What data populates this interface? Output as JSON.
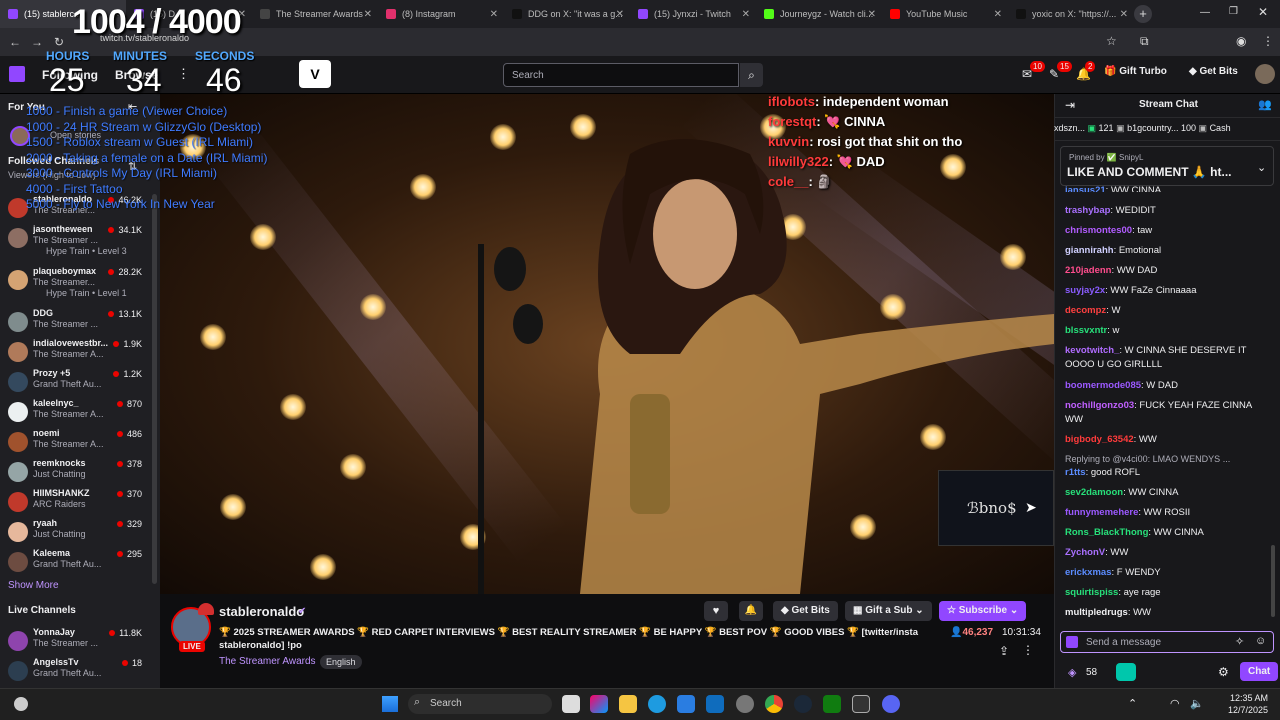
{
  "colors": {
    "accent": "#9147ff",
    "live_red": "#eb0400",
    "timer_blue": "#52a9ff"
  },
  "browser": {
    "tabs": [
      {
        "title": "(15) stablerc...",
        "color": "#9147ff"
      },
      {
        "title": "(15) D...",
        "color": "#9147ff"
      },
      {
        "title": "The Streamer Awards",
        "color": "#444"
      },
      {
        "title": "(8) Instagram",
        "color": "#e1306c"
      },
      {
        "title": "DDG on X: \"it was a g...",
        "color": "#111"
      },
      {
        "title": "(15) Jynxzi - Twitch",
        "color": "#9147ff"
      },
      {
        "title": "Journeygz - Watch cli...",
        "color": "#53fc18"
      },
      {
        "title": "YouTube Music",
        "color": "#ff0000"
      },
      {
        "title": "yoxic on X: \"https://...",
        "color": "#111"
      }
    ],
    "url": "twitch.tv/stableronaldo"
  },
  "topnav": {
    "following": "Following",
    "browse": "Browse",
    "search_placeholder": "Search",
    "badges": [
      "10",
      "15",
      "2"
    ],
    "gift_turbo": "Gift Turbo",
    "get_bits": "Get Bits"
  },
  "timer": {
    "progress": "1004 / 4000",
    "hours_label": "HOURS",
    "minutes_label": "MINUTES",
    "seconds_label": "SECONDS",
    "hours": "25",
    "minutes": "34",
    "seconds": "46",
    "goals": [
      "1000 - Finish a game (Viewer Choice)",
      "1000 - 24 HR Stream w GlizzyGlo (Desktop)",
      "1500 - Roblox stream w Guest (IRL Miami)",
      "2000 - Taking a female on a Date (IRL Miami)",
      "3000 - Controls My Day (IRL Miami)",
      "4000 - First Tattoo",
      "5000 - Fly to New York In New Year"
    ]
  },
  "sidebar": {
    "for_you": "For You",
    "open_stories": "Open stories",
    "followed": "Followed Channels",
    "sort": "Viewers (High to Low)",
    "channels": [
      {
        "name": "stableronaldo",
        "category": "The Streamer...",
        "viewers": "46.2K",
        "sub": "",
        "color": "#c0392b"
      },
      {
        "name": "jasontheween",
        "category": "The Streamer ...",
        "viewers": "34.1K",
        "sub": "Hype Train • Level 3",
        "color": "#8d6e63"
      },
      {
        "name": "plaqueboymax",
        "category": "The Streamer...",
        "viewers": "28.2K",
        "sub": "Hype Train • Level 1",
        "color": "#d4a373"
      },
      {
        "name": "DDG",
        "category": "The Streamer ...",
        "viewers": "13.1K",
        "sub": "",
        "color": "#7f8c8d"
      },
      {
        "name": "indialovewestbr...",
        "category": "The Streamer A...",
        "viewers": "1.9K",
        "sub": "",
        "color": "#b07a5a"
      },
      {
        "name": "Prozy +5",
        "category": "Grand Theft Au...",
        "viewers": "1.2K",
        "sub": "",
        "color": "#34495e"
      },
      {
        "name": "kaleelnyc_",
        "category": "The Streamer A...",
        "viewers": "870",
        "sub": "",
        "color": "#ecf0f1"
      },
      {
        "name": "noemi",
        "category": "The Streamer A...",
        "viewers": "486",
        "sub": "",
        "color": "#a0522d"
      },
      {
        "name": "reemknocks",
        "category": "Just Chatting",
        "viewers": "378",
        "sub": "",
        "color": "#95a5a6"
      },
      {
        "name": "HIIMSHANKZ",
        "category": "ARC Raiders",
        "viewers": "370",
        "sub": "",
        "color": "#c0392b"
      },
      {
        "name": "ryaah",
        "category": "Just Chatting",
        "viewers": "329",
        "sub": "",
        "color": "#e6b89c"
      },
      {
        "name": "Kaleema",
        "category": "Grand Theft Au...",
        "viewers": "295",
        "sub": "",
        "color": "#6d4c41"
      }
    ],
    "show_more": "Show More",
    "live_channels": "Live Channels",
    "live": [
      {
        "name": "YonnaJay",
        "category": "The Streamer ...",
        "viewers": "11.8K",
        "color": "#8e44ad"
      },
      {
        "name": "AngelssTv",
        "category": "Grand Theft Au...",
        "viewers": "18",
        "color": "#2c3e50"
      }
    ]
  },
  "overlay_chat": [
    {
      "user": "iflobots",
      "text": ": independent woman"
    },
    {
      "user": "forestqt",
      "text": ": 💘 CINNA"
    },
    {
      "user": "kuvvin",
      "text": ": rosi got that shit on tho"
    },
    {
      "user": "lilwilly322",
      "text": ": 💘 DAD"
    },
    {
      "user": "cole__",
      "text": ": 🗿"
    }
  ],
  "stream": {
    "streamer": "stableronaldo",
    "title": "🏆 2025 STREAMER AWARDS 🏆 RED CARPET INTERVIEWS 🏆 BEST REALITY STREAMER 🏆 BE HAPPY 🏆 BEST POV 🏆 GOOD VIBES 🏆 [twitter/insta stableronaldo] !po",
    "category": "The Streamer Awards",
    "tag": "English",
    "live_label": "LIVE",
    "viewers": "46,237",
    "uptime": "10:31:34",
    "get_bits": "Get Bits",
    "gift_sub": "Gift a Sub",
    "subscribe": "Subscribe",
    "watermark": "ℬbno$"
  },
  "chat": {
    "title": "Stream Chat",
    "leaderboard": [
      {
        "name": "xdszn...",
        "val": ""
      },
      {
        "name": "121",
        "val": ""
      },
      {
        "name": "b1gcountry...",
        "val": "100"
      },
      {
        "name": "Cash",
        "val": ""
      }
    ],
    "pinned_by": "Pinned by ✅ SnipyL",
    "pinned": "LIKE AND COMMENT 🙏 ht...",
    "messages": [
      {
        "user": "jansus21",
        "text": ": WW CINNA",
        "color": "#5b8cff"
      },
      {
        "user": "trashybap",
        "text": ": WEDIDIT",
        "color": "#a970ff"
      },
      {
        "user": "chrismontes00",
        "text": ": taw",
        "color": "#b15cff"
      },
      {
        "user": "giannirahh",
        "text": ": Emotional",
        "color": "#d0d0ff"
      },
      {
        "user": "210jadenn",
        "text": ": WW DAD",
        "color": "#ff4d8d"
      },
      {
        "user": "suyjay2x",
        "text": ": WW FaZe Cinnaaaa",
        "color": "#8a5cff"
      },
      {
        "user": "decompz",
        "text": ": W",
        "color": "#ff4040"
      },
      {
        "user": "blssvxntr",
        "text": ": w",
        "color": "#27e07a"
      },
      {
        "user": "kevotwitch_",
        "text": ": W CINNA SHE DESERVE IT OOOO U GO GIRLLLL",
        "color": "#b06cff"
      },
      {
        "user": "boomermode085",
        "text": ": W DAD",
        "color": "#9b59ff"
      },
      {
        "user": "nochillgonzo03",
        "text": ": FUCK YEAH FAZE CINNA WW",
        "color": "#c060ff"
      },
      {
        "user": "bigbody_63542",
        "text": ": WW",
        "color": "#ff3b3b"
      },
      {
        "user": "r1tts",
        "text": ": good ROFL",
        "color": "#5b8cff",
        "reply": "Replying to @v4ci00: LMAO WENDYS ..."
      },
      {
        "user": "sev2damoon",
        "text": ": WW CINNA",
        "color": "#27e07a"
      },
      {
        "user": "funnymemehere",
        "text": ": WW ROSII",
        "color": "#9b59ff"
      },
      {
        "user": "Rons_BlackThong",
        "text": ": WW CINNA",
        "color": "#27e07a"
      },
      {
        "user": "ZychonV",
        "text": ": WW",
        "color": "#a970ff"
      },
      {
        "user": "erickxmas",
        "text": ": F WENDY",
        "color": "#5b8cff"
      },
      {
        "user": "squirtispiss",
        "text": ": aye rage",
        "color": "#27e07a"
      },
      {
        "user": "multipledrugs",
        "text": ": WW",
        "color": "#efeff1"
      }
    ],
    "input_placeholder": "Send a message",
    "points": "58",
    "chat_button": "Chat"
  },
  "taskbar": {
    "search": "Search",
    "time": "12:35 AM",
    "date": "12/7/2025"
  }
}
